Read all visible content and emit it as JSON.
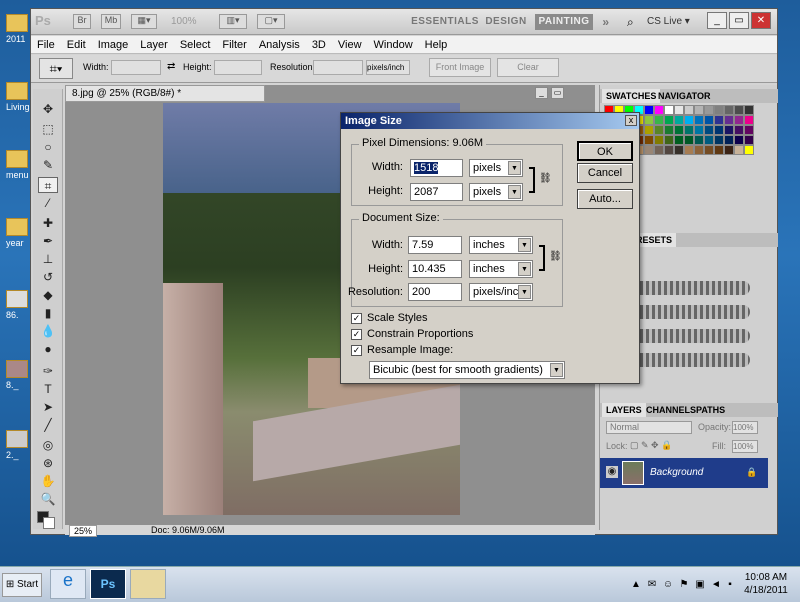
{
  "desktop": {
    "icons": [
      {
        "label": "2011"
      },
      {
        "label": "Living"
      },
      {
        "label": "menu"
      },
      {
        "label": "year"
      },
      {
        "label": "86."
      },
      {
        "label": "8._"
      },
      {
        "label": "2._"
      }
    ]
  },
  "appbar": {
    "logo": "Ps",
    "zoom": "100%",
    "workspaces": [
      "ESSENTIALS",
      "DESIGN",
      "PAINTING"
    ],
    "active_workspace": "PAINTING",
    "more": "»",
    "cslive": "CS Live"
  },
  "menu": [
    "File",
    "Edit",
    "Image",
    "Layer",
    "Select",
    "Filter",
    "Analysis",
    "3D",
    "View",
    "Window",
    "Help"
  ],
  "options": {
    "width_label": "Width:",
    "height_label": "Height:",
    "resolution_label": "Resolution:",
    "unit": "pixels/inch",
    "front_image": "Front Image",
    "clear": "Clear"
  },
  "document": {
    "tab": "8.jpg @ 25% (RGB/8#) *",
    "zoom": "25%",
    "doc_info": "Doc: 9.06M/9.06M"
  },
  "panels": {
    "swatches_tab": "SWATCHES",
    "navigator_tab": "NAVIGATOR",
    "presets_tab": "RESETS",
    "layers_tab": "LAYERS",
    "channels_tab": "CHANNELS",
    "paths_tab": "PATHS",
    "blend_mode": "Normal",
    "opacity_label": "Opacity:",
    "opacity_value": "100%",
    "lock_label": "Lock:",
    "fill_label": "Fill:",
    "fill_value": "100%",
    "layer_name": "Background",
    "swatch_colors": [
      "#ff0000",
      "#ffff00",
      "#00ff00",
      "#00ffff",
      "#0000ff",
      "#ff00ff",
      "#ffffff",
      "#e6e6e6",
      "#cccccc",
      "#b3b3b3",
      "#999999",
      "#808080",
      "#666666",
      "#4d4d4d",
      "#333333",
      "#ed1c24",
      "#f26522",
      "#f7941d",
      "#fff200",
      "#8dc63f",
      "#39b54a",
      "#00a651",
      "#00a99d",
      "#00aeef",
      "#0072bc",
      "#0054a6",
      "#2e3192",
      "#662d91",
      "#92278f",
      "#ec008c",
      "#ed145b",
      "#9e0b0f",
      "#a0410d",
      "#a36209",
      "#aba000",
      "#598527",
      "#1a7b30",
      "#007236",
      "#00746b",
      "#0076a3",
      "#004a80",
      "#003471",
      "#1b1464",
      "#440e62",
      "#630460",
      "#9e005d",
      "#9e0039",
      "#790000",
      "#7b2e00",
      "#7d4900",
      "#827b00",
      "#406618",
      "#005e20",
      "#005826",
      "#005952",
      "#005b7f",
      "#003663",
      "#002157",
      "#0d004c",
      "#32004b",
      "#4b0049",
      "#7b0046",
      "#7a0026",
      "#c69c6d",
      "#998675",
      "#736357",
      "#534741",
      "#37302a",
      "#a67c52",
      "#8c6239",
      "#754c24",
      "#603913",
      "#3c2415",
      "#c7b299",
      "#ffff00",
      "#ff0000",
      "#ff00ff"
    ]
  },
  "dialog": {
    "title": "Image Size",
    "close": "x",
    "pixel_dimensions": "Pixel Dimensions:  9.06M",
    "width_label": "Width:",
    "height_label": "Height:",
    "pixel_width": "1518",
    "pixel_height": "2087",
    "pixel_unit": "pixels",
    "document_size": "Document Size:",
    "doc_width": "7.59",
    "doc_height": "10.435",
    "resolution_label": "Resolution:",
    "resolution": "200",
    "doc_unit": "inches",
    "res_unit": "pixels/inch",
    "scale_styles": "Scale Styles",
    "constrain": "Constrain Proportions",
    "resample": "Resample Image:",
    "resample_method": "Bicubic (best for smooth gradients)",
    "ok": "OK",
    "cancel": "Cancel",
    "auto": "Auto..."
  },
  "taskbar": {
    "start": "Start",
    "time": "10:08 AM",
    "date": "4/18/2011",
    "ps_label": "Ps"
  }
}
